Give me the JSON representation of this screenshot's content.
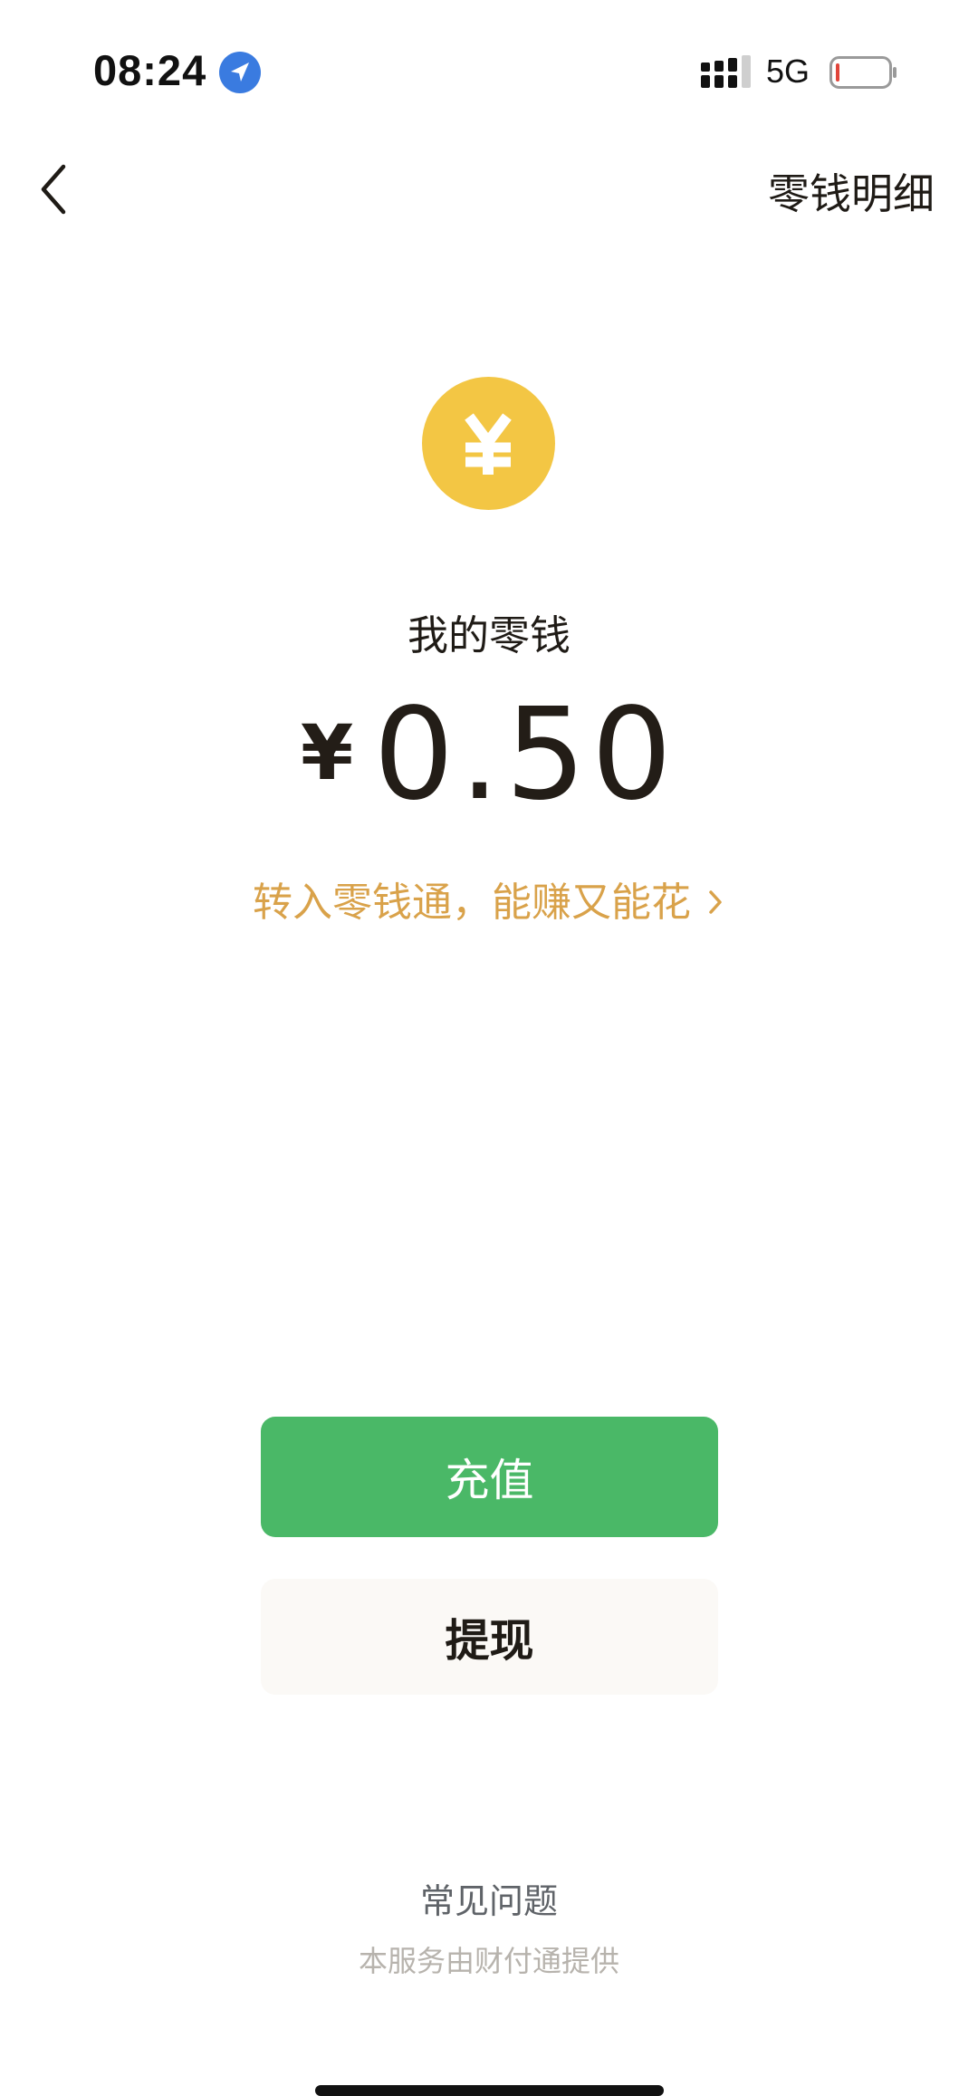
{
  "status_bar": {
    "time": "08:24",
    "location_icon": "location-arrow-icon",
    "signal_icon": "signal-bars-icon",
    "network": "5G",
    "battery_icon": "battery-low-icon"
  },
  "nav": {
    "back_icon": "chevron-left-icon",
    "detail_label": "零钱明细"
  },
  "wallet": {
    "coin_symbol": "¥",
    "coin_color": "#f3c644",
    "title": "我的零钱",
    "currency_symbol": "¥",
    "amount": "0.50",
    "promo_text": "转入零钱通，能赚又能花",
    "promo_color": "#d9a24a"
  },
  "actions": {
    "recharge_label": "充值",
    "recharge_color": "#4ab867",
    "withdraw_label": "提现"
  },
  "footer": {
    "faq_label": "常见问题",
    "provider_text": "本服务由财付通提供"
  }
}
